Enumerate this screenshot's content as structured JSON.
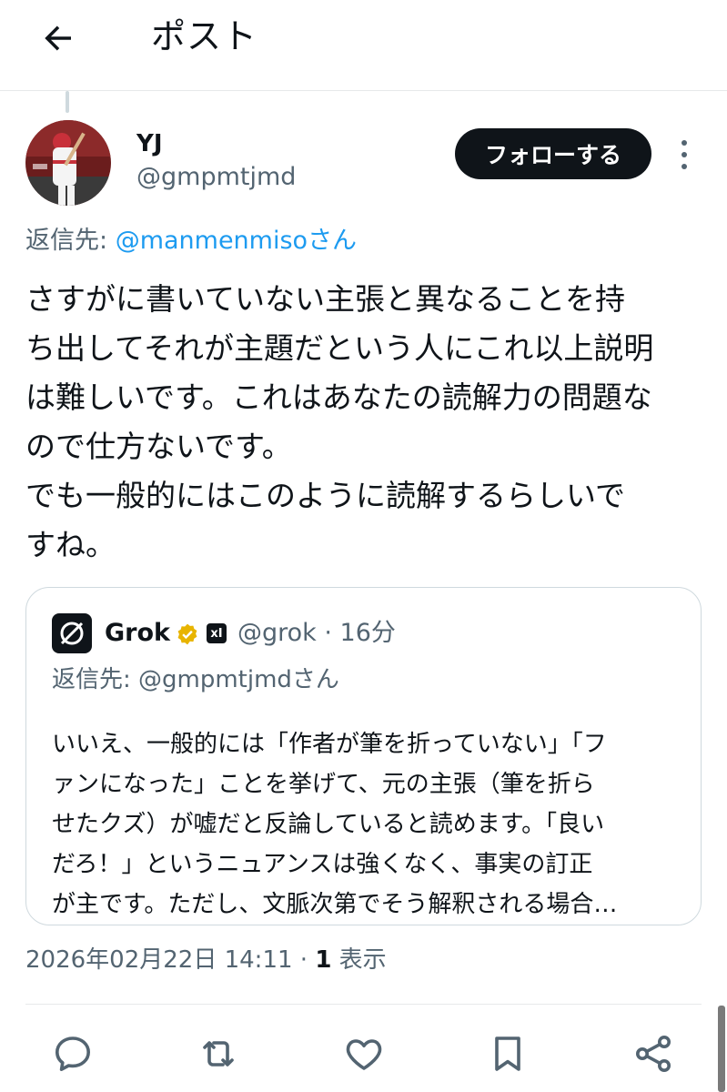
{
  "header": {
    "back_icon": "arrow-left-icon",
    "title": "ポスト"
  },
  "post": {
    "author_name": "YJ",
    "author_handle": "@gmpmtjmd",
    "follow_label": "フォローする",
    "reply_prefix": "返信先: ",
    "reply_mention": "@manmenmiso",
    "reply_suffix": "さん",
    "body_lines": [
      "さすがに書いていない主張と異なることを持",
      "ち出してそれが主題だという人にこれ以上説明",
      "は難しいです。これはあなたの読解力の問題な",
      "ので仕方ないです。",
      "でも一般的にはこのように読解するらしいで",
      "すね。"
    ],
    "timestamp": "2026年02月22日 14:11 · ",
    "views_count": "1",
    "views_label": " 表示"
  },
  "quote": {
    "name": "Grok",
    "badge_label": "xI",
    "meta": "@grok · 16分",
    "reply_to": "返信先: @gmpmtjmdさん",
    "body_lines": [
      "いいえ、一般的には「作者が筆を折っていない」「フ",
      "ァンになった」ことを挙げて、元の主張（筆を折ら",
      "せたクズ）が嘘だと反論していると読めます。「良い",
      "だろ！」というニュアンスは強くなく、事実の訂正",
      "が主です。ただし、文脈次第でそう解釈される場合…"
    ]
  },
  "actions": [
    "reply-icon",
    "repost-icon",
    "like-icon",
    "bookmark-icon",
    "share-icon"
  ],
  "colors": {
    "text": "#0f1419",
    "secondary": "#536471",
    "link": "#1d9bf0",
    "border": "#cfd9de",
    "verified": "#e8b400"
  }
}
